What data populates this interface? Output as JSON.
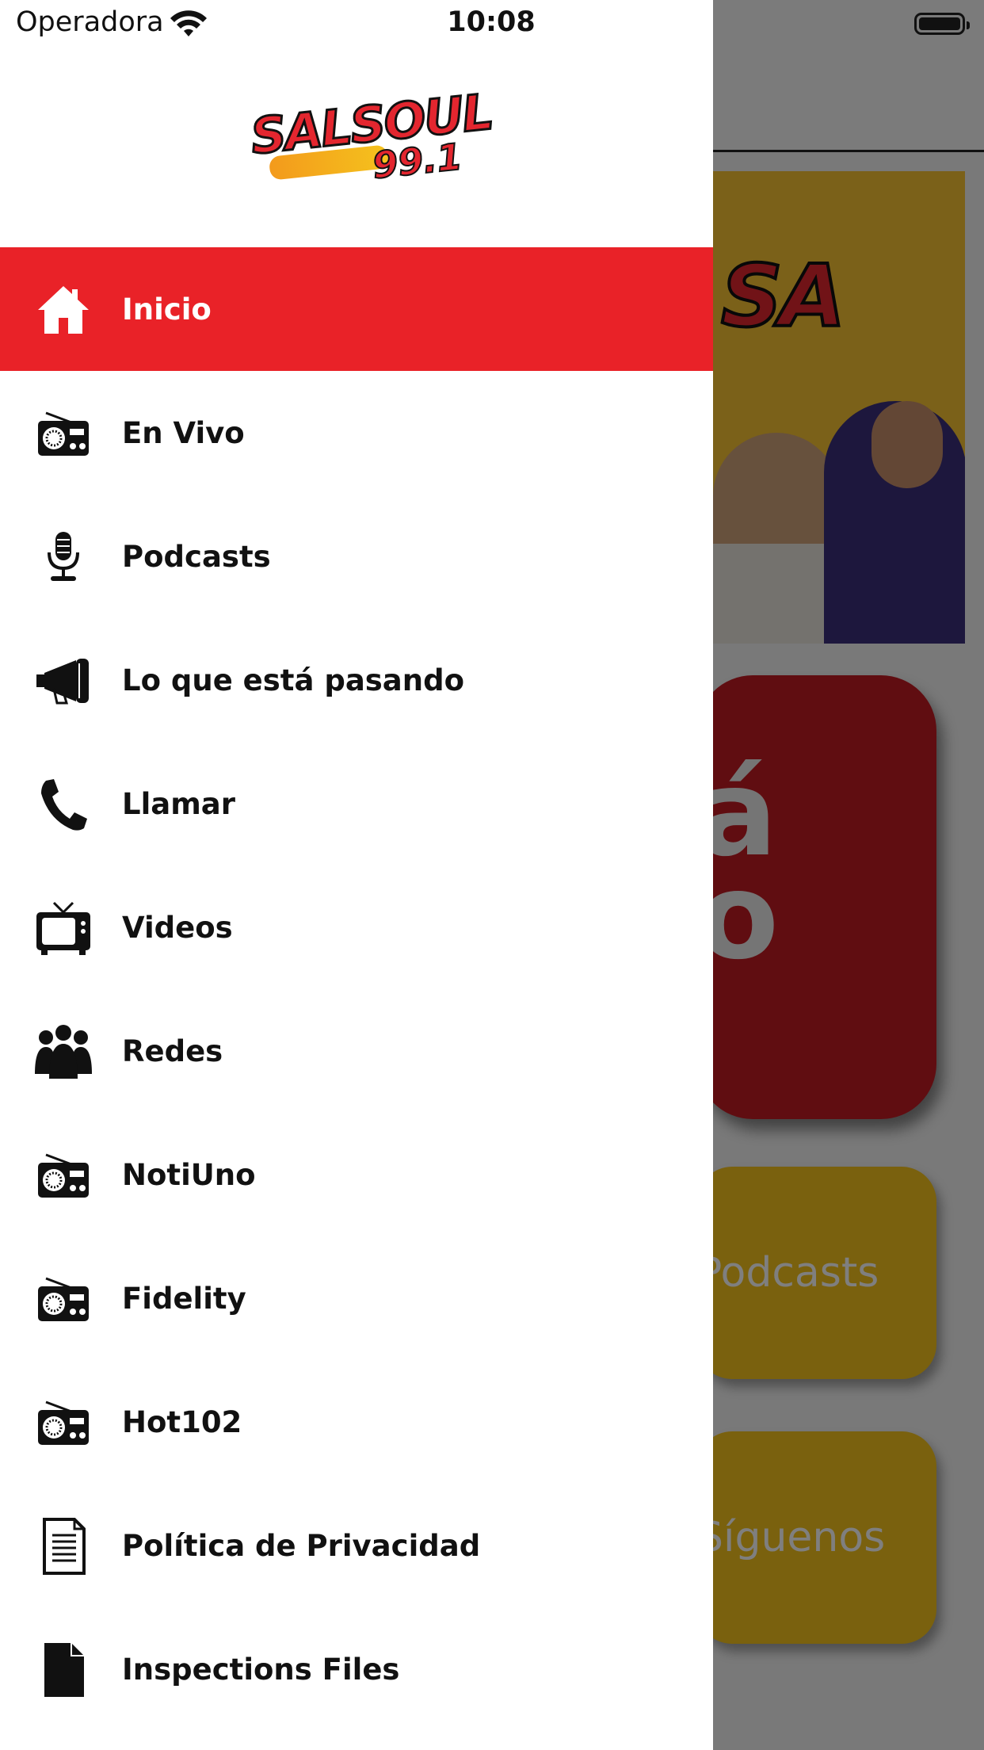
{
  "status_bar": {
    "carrier": "Operadora",
    "time": "10:08"
  },
  "brand": {
    "name": "SALSOUL",
    "frequency": "99.1"
  },
  "menu": [
    {
      "label": "Inicio",
      "icon": "home-icon",
      "active": true
    },
    {
      "label": "En Vivo",
      "icon": "radio-icon",
      "active": false
    },
    {
      "label": "Podcasts",
      "icon": "microphone-icon",
      "active": false
    },
    {
      "label": "Lo que está pasando",
      "icon": "megaphone-icon",
      "active": false
    },
    {
      "label": "Llamar",
      "icon": "phone-icon",
      "active": false
    },
    {
      "label": "Videos",
      "icon": "tv-icon",
      "active": false
    },
    {
      "label": "Redes",
      "icon": "people-icon",
      "active": false
    },
    {
      "label": "NotiUno",
      "icon": "radio-icon",
      "active": false
    },
    {
      "label": "Fidelity",
      "icon": "radio-icon",
      "active": false
    },
    {
      "label": "Hot102",
      "icon": "radio-icon",
      "active": false
    },
    {
      "label": "Política de Privacidad",
      "icon": "document-icon",
      "active": false
    },
    {
      "label": "Inspections Files",
      "icon": "file-icon",
      "active": false
    }
  ],
  "background": {
    "banner_text": "SA",
    "live_card_text": "á\no",
    "podcasts_card": "Podcasts",
    "follow_card": "Síguenos"
  },
  "colors": {
    "active": "#e92228",
    "accent_yellow": "#f5c21d",
    "live_red": "#c01a22"
  }
}
